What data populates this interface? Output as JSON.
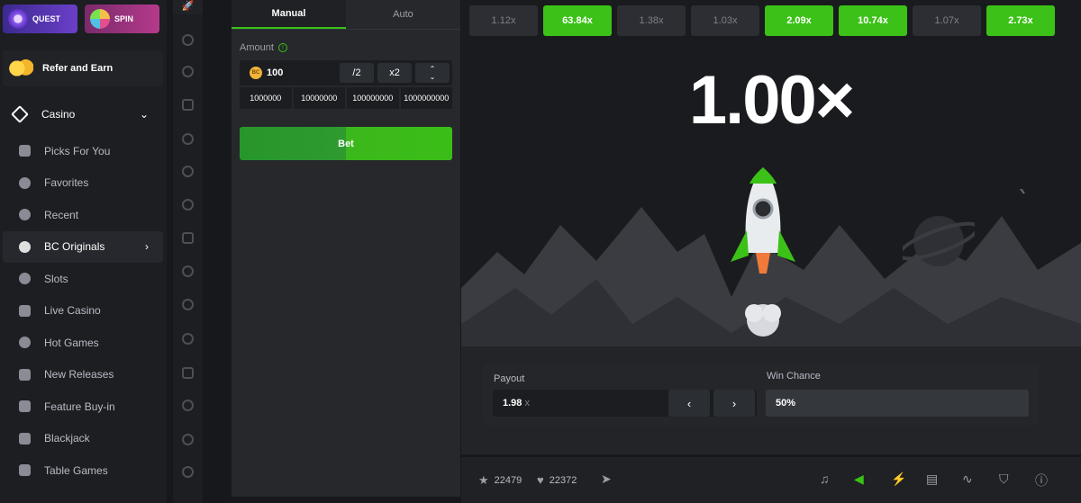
{
  "sidebar": {
    "quest_label": "QUEST",
    "spin_label": "SPIN",
    "refer_label": "Refer and Earn",
    "casino_label": "Casino",
    "items": [
      {
        "label": "Picks For You",
        "icon": "grid-icon"
      },
      {
        "label": "Favorites",
        "icon": "star-icon"
      },
      {
        "label": "Recent",
        "icon": "clock-icon"
      },
      {
        "label": "BC Originals",
        "icon": "dice-icon",
        "active": true
      },
      {
        "label": "Slots",
        "icon": "slot-icon"
      },
      {
        "label": "Live Casino",
        "icon": "live-icon"
      },
      {
        "label": "Hot Games",
        "icon": "fire-icon"
      },
      {
        "label": "New Releases",
        "icon": "rocket-icon"
      },
      {
        "label": "Feature Buy-in",
        "icon": "star-icon"
      },
      {
        "label": "Blackjack",
        "icon": "cards-icon"
      },
      {
        "label": "Table Games",
        "icon": "table-icon"
      }
    ]
  },
  "bet_panel": {
    "tabs": [
      "Manual",
      "Auto"
    ],
    "amount_label": "Amount",
    "coin_symbol": "BC",
    "amount_value": "100",
    "half_label": "/2",
    "double_label": "x2",
    "quick_amounts": [
      "1000000",
      "10000000",
      "100000000",
      "1000000000"
    ],
    "bet_label": "Bet"
  },
  "game": {
    "history": [
      {
        "value": "1.12x",
        "win": false
      },
      {
        "value": "63.84x",
        "win": true
      },
      {
        "value": "1.38x",
        "win": false
      },
      {
        "value": "1.03x",
        "win": false
      },
      {
        "value": "2.09x",
        "win": true
      },
      {
        "value": "10.74x",
        "win": true
      },
      {
        "value": "1.07x",
        "win": false
      },
      {
        "value": "2.73x",
        "win": true
      }
    ],
    "multiplier": "1.00×",
    "payout_label": "Payout",
    "payout_value": "1.98",
    "payout_suffix": "x",
    "win_chance_label": "Win Chance",
    "win_chance_value": "50%"
  },
  "footer": {
    "likes": "22479",
    "hearts": "22372"
  },
  "colors": {
    "accent": "#3bc117",
    "bg": "#17181b",
    "panel": "#26282c"
  }
}
